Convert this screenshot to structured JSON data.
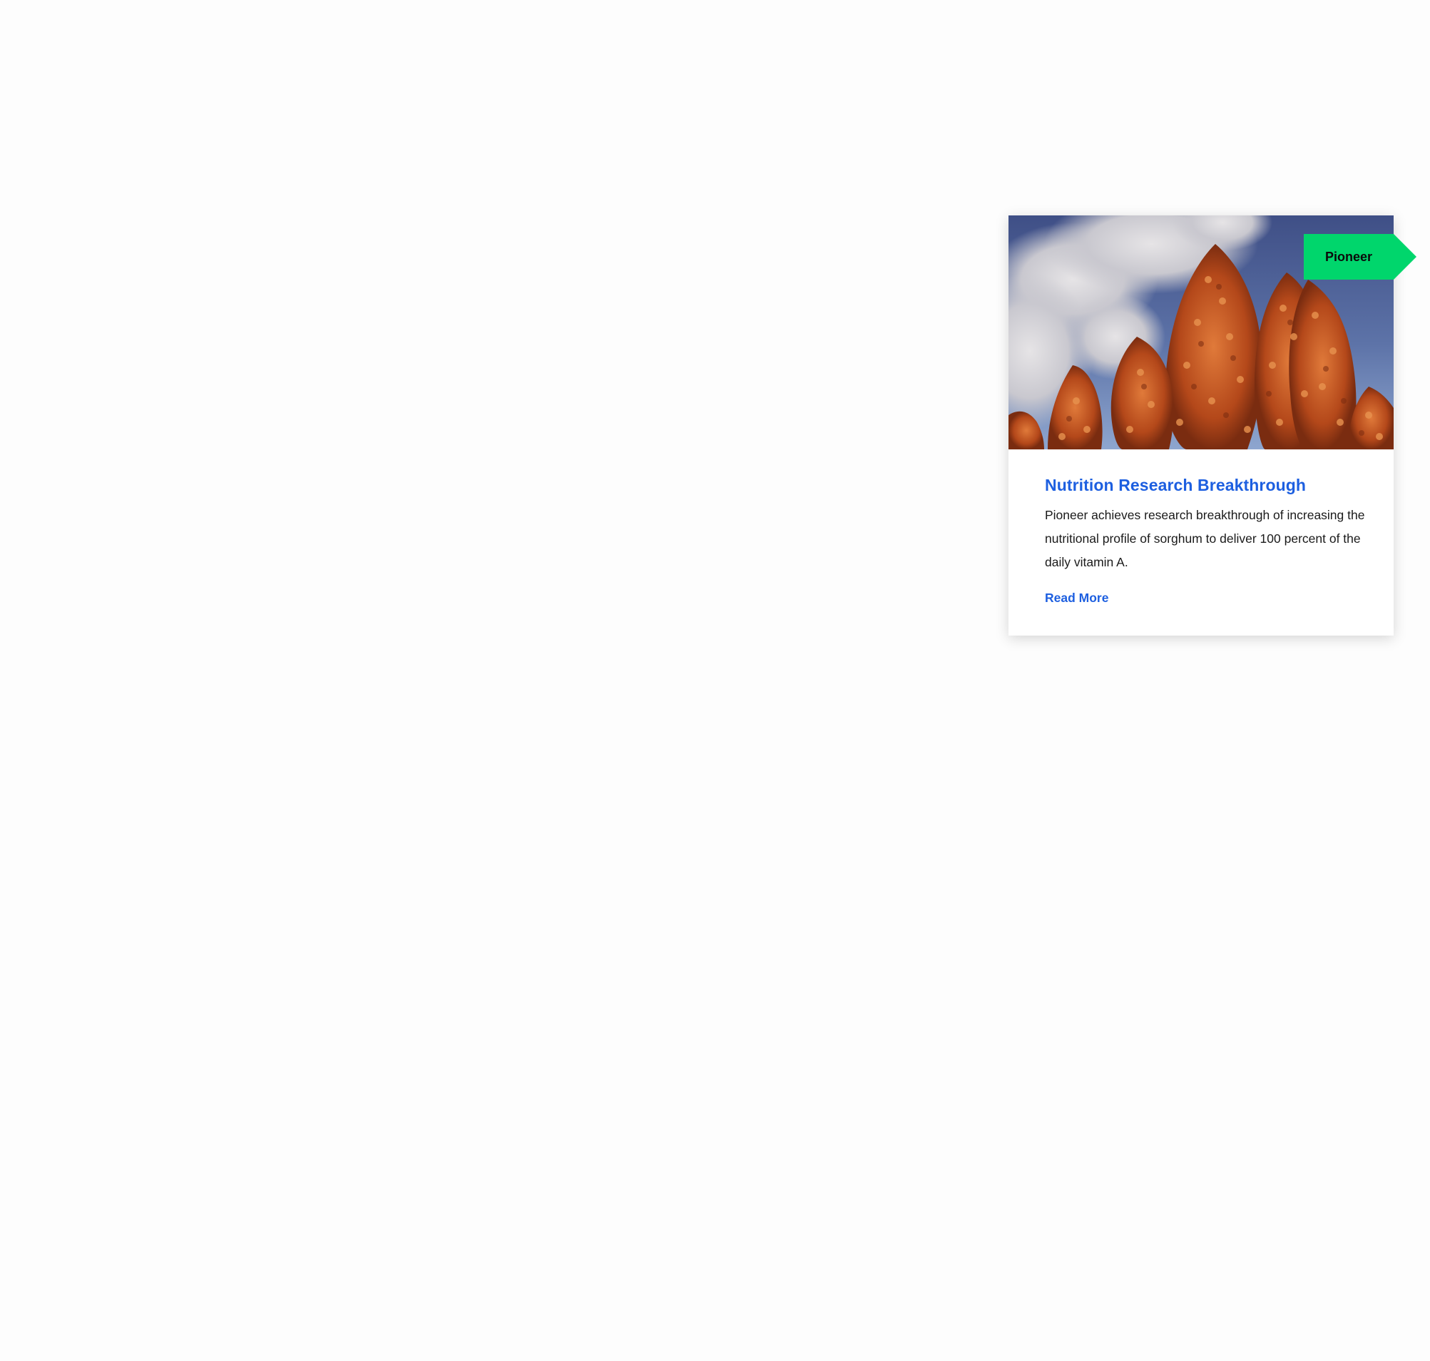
{
  "card": {
    "tag_label": "Pioneer",
    "title": "Nutrition Research Breakthrough",
    "description": "Pioneer achieves research breakthrough of increasing the nutritional profile of sorghum to deliver 100 percent of the daily vitamin A.",
    "link_label": "Read More"
  },
  "colors": {
    "tag_background": "#00d66c",
    "title": "#1d5fe0",
    "link": "#1d5fe0",
    "sky": "#4a5d96",
    "sorghum": "#c2541f"
  },
  "image": {
    "subject": "sorghum-heads-photo"
  }
}
